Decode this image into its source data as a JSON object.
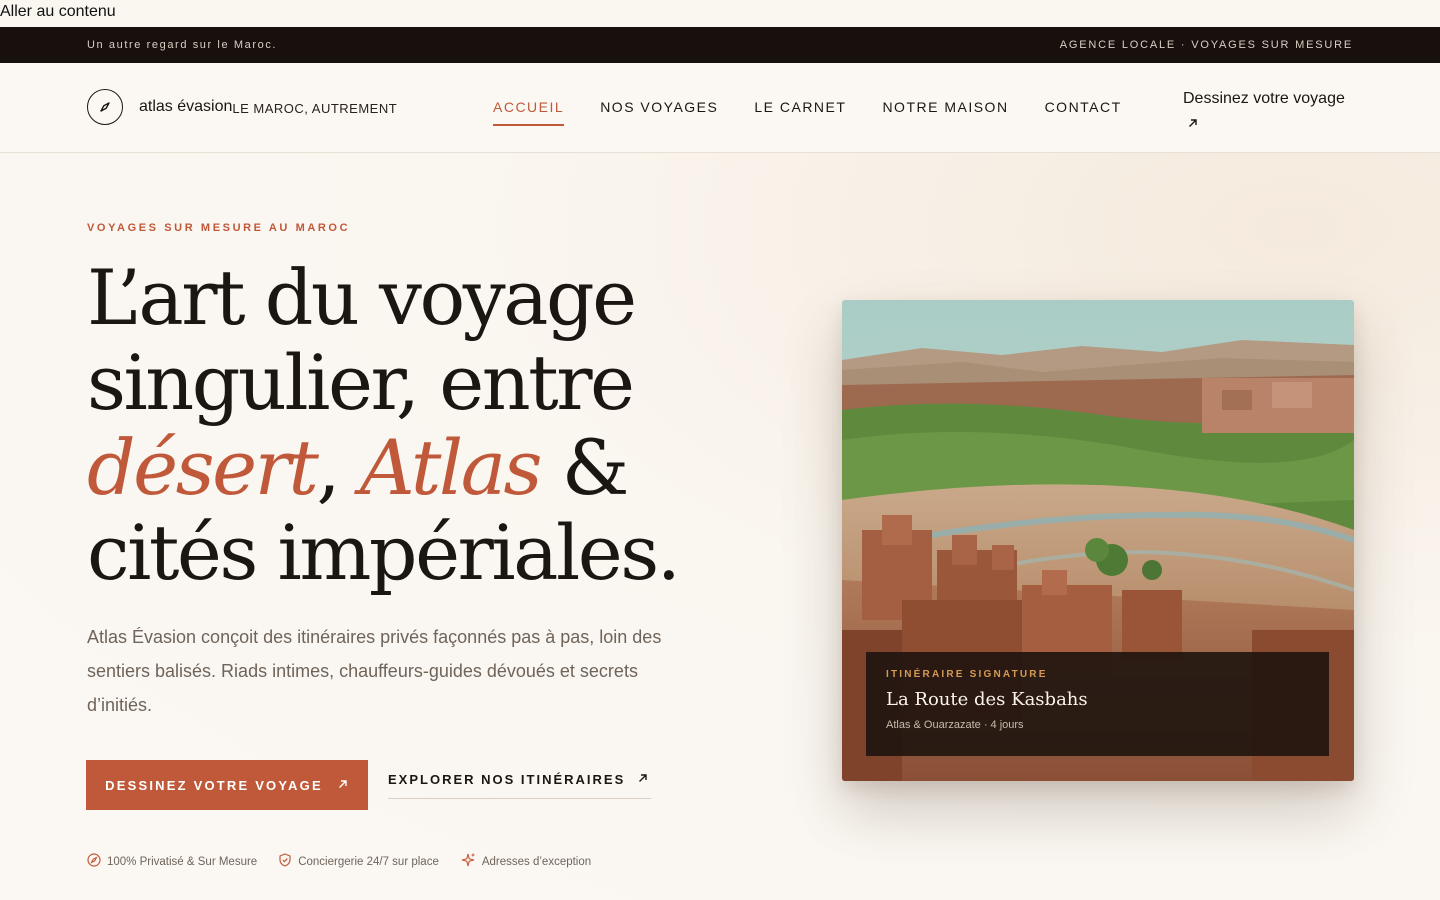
{
  "skip_link": "Aller au contenu",
  "topbar": {
    "tagline": "Un autre regard sur le Maroc.",
    "right": "AGENCE LOCALE · VOYAGES SUR MESURE"
  },
  "nav": {
    "brand_name": "atlas évasion",
    "brand_tagline": "LE MAROC, AUTREMENT",
    "items": [
      {
        "label": "ACCUEIL",
        "active": true
      },
      {
        "label": "NOS VOYAGES"
      },
      {
        "label": "LE CARNET"
      },
      {
        "label": "NOTRE MAISON"
      },
      {
        "label": "CONTACT"
      }
    ],
    "cta_label": "Dessinez votre voyage",
    "cta_icon": "arrow-up-right-icon"
  },
  "hero": {
    "eyebrow": "VOYAGES SUR MESURE AU MAROC",
    "headline": {
      "part1": "L’art du voyage singulier, entre ",
      "em1": "désert",
      "sep": ", ",
      "em2": "Atlas",
      "part2": " & cités impériales."
    },
    "lede": "Atlas Évasion conçoit des itinéraires privés façonnés pas à pas, loin des sentiers balisés. Riads intimes, chauffeurs-guides dévoués et secrets d’initiés.",
    "primary_cta": "DESSINEZ VOTRE VOYAGE",
    "secondary_cta": "EXPLORER NOS ITINÉRAIRES",
    "badges": [
      {
        "icon": "compass-icon",
        "label": "100% Privatisé & Sur Mesure"
      },
      {
        "icon": "shield-check-icon",
        "label": "Conciergerie 24/7 sur place"
      },
      {
        "icon": "sparkle-icon",
        "label": "Adresses d’exception"
      }
    ]
  },
  "feature_card": {
    "kicker": "ITINÉRAIRE SIGNATURE",
    "title": "La Route des Kasbahs",
    "meta": "Atlas & Ouarzazate · 4 jours"
  },
  "colors": {
    "accent": "#c0593a",
    "dark": "#17100c",
    "background": "#faf6f0",
    "gold": "#d49a55"
  }
}
